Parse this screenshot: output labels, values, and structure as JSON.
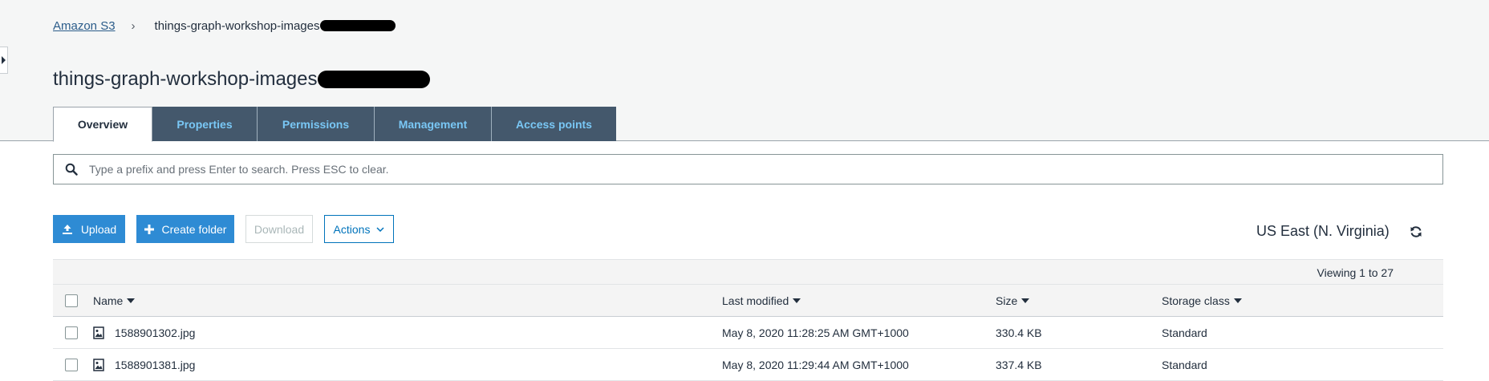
{
  "breadcrumb": {
    "root": "Amazon S3",
    "separator": "›",
    "current": "things-graph-workshop-images"
  },
  "page_title": "things-graph-workshop-images",
  "tabs": [
    {
      "label": "Overview",
      "active": true
    },
    {
      "label": "Properties",
      "active": false
    },
    {
      "label": "Permissions",
      "active": false
    },
    {
      "label": "Management",
      "active": false
    },
    {
      "label": "Access points",
      "active": false
    }
  ],
  "search": {
    "placeholder": "Type a prefix and press Enter to search. Press ESC to clear.",
    "value": "",
    "icon": "search-icon"
  },
  "toolbar": {
    "upload_label": "Upload",
    "create_folder_label": "Create folder",
    "download_label": "Download",
    "actions_label": "Actions",
    "region": "US East (N. Virginia)",
    "refresh_icon": "refresh-icon"
  },
  "table": {
    "viewing": "Viewing 1 to 27",
    "columns": {
      "name": "Name",
      "last_modified": "Last modified",
      "size": "Size",
      "storage_class": "Storage class"
    },
    "rows": [
      {
        "name": "1588901302.jpg",
        "last_modified": "May 8, 2020 11:28:25 AM GMT+1000",
        "size": "330.4 KB",
        "storage_class": "Standard"
      },
      {
        "name": "1588901381.jpg",
        "last_modified": "May 8, 2020 11:29:44 AM GMT+1000",
        "size": "337.4 KB",
        "storage_class": "Standard"
      }
    ]
  },
  "colors": {
    "primary": "#2e8bd4",
    "tab_bg": "#44586c",
    "tab_text": "#79c7f5",
    "link": "#2b5c8a"
  }
}
